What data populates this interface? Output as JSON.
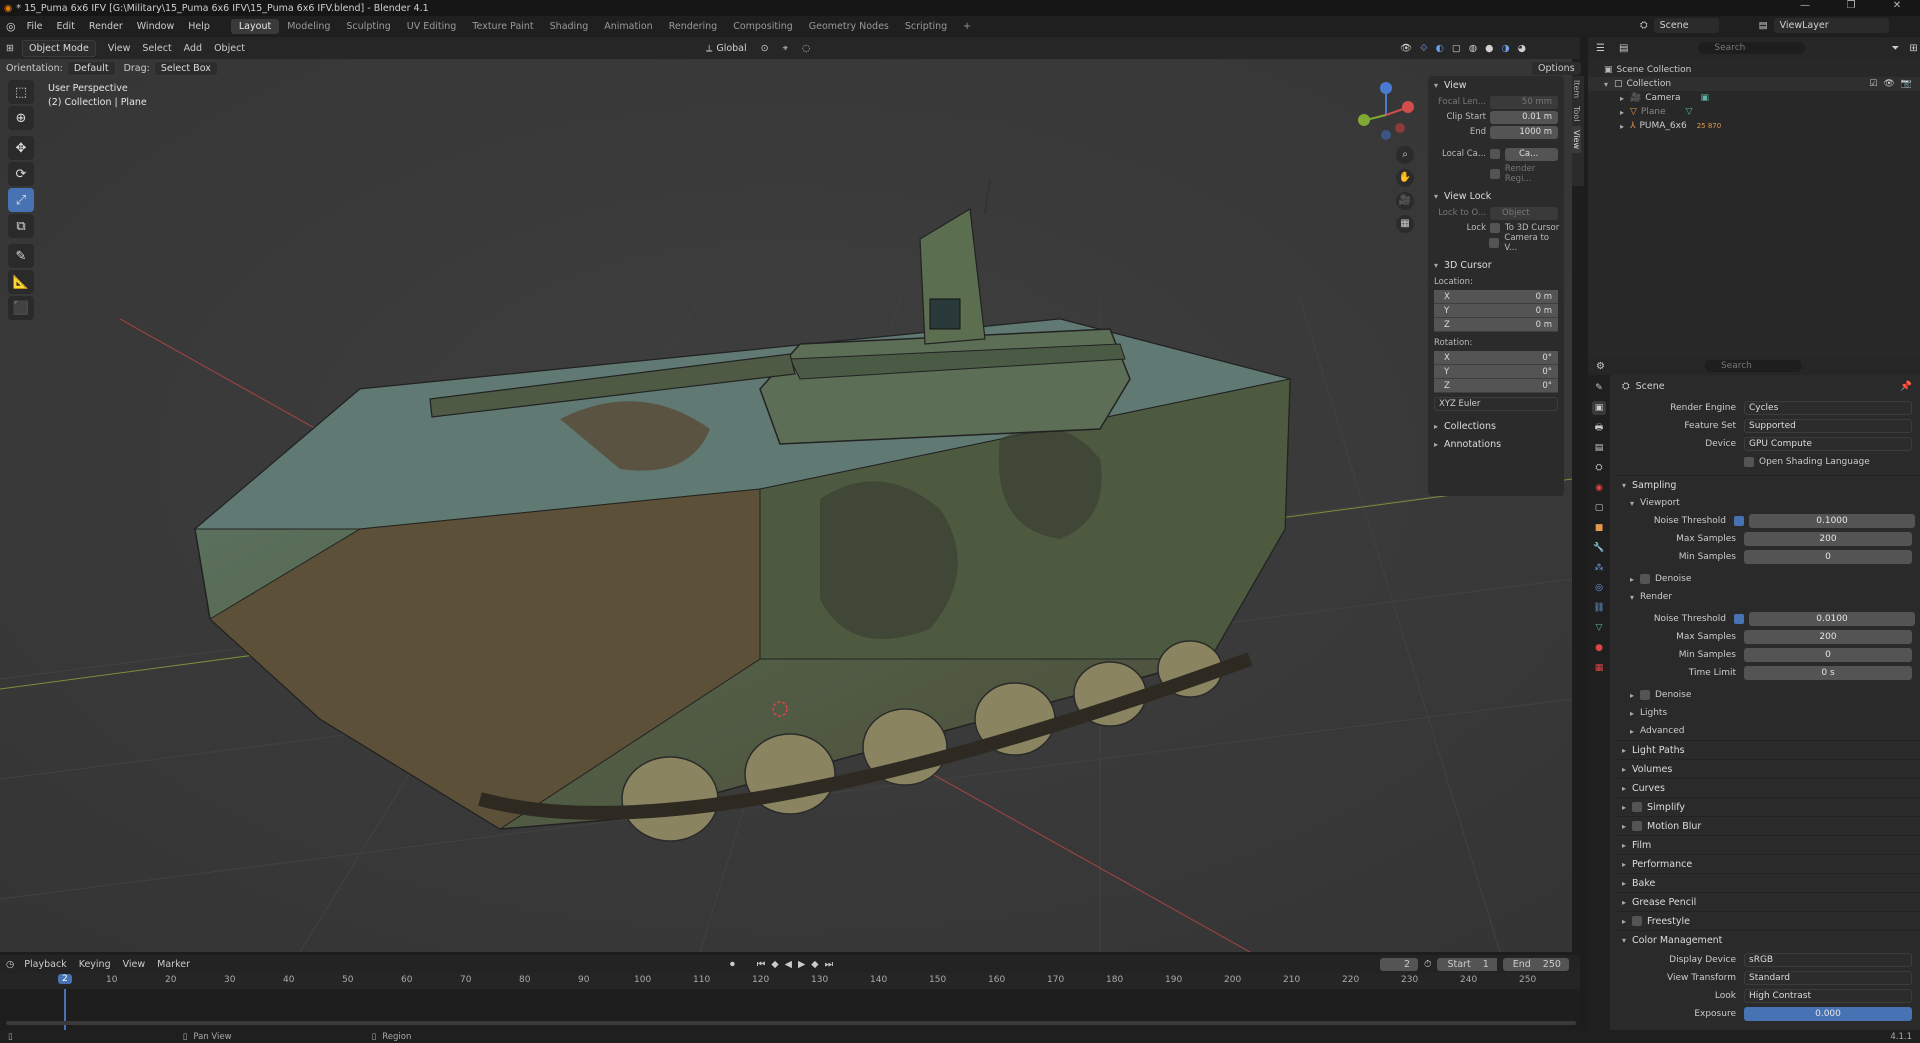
{
  "window": {
    "title": "* 15_Puma 6x6 IFV [G:\\Military\\15_Puma 6x6 IFV\\15_Puma 6x6 IFV.blend] - Blender 4.1",
    "controls": [
      "—",
      "❐",
      "✕"
    ]
  },
  "menu": {
    "items": [
      "File",
      "Edit",
      "Render",
      "Window",
      "Help"
    ],
    "workspaces": [
      "Layout",
      "Modeling",
      "Sculpting",
      "UV Editing",
      "Texture Paint",
      "Shading",
      "Animation",
      "Rendering",
      "Compositing",
      "Geometry Nodes",
      "Scripting"
    ],
    "active_workspace": "Layout",
    "add_tab": "+",
    "scene_label": "Scene",
    "viewlayer_label": "ViewLayer"
  },
  "viewport_header": {
    "mode": "Object Mode",
    "menus": [
      "View",
      "Select",
      "Add",
      "Object"
    ],
    "transform_orientation": "Global",
    "options_label": "Options",
    "orientation_label": "Orientation:",
    "orientation_value": "Default",
    "drag_label": "Drag:",
    "drag_value": "Select Box"
  },
  "viewport_info": {
    "line1": "User Perspective",
    "line2": "(2) Collection | Plane"
  },
  "npanel": {
    "tabs": [
      "Item",
      "Tool",
      "View"
    ],
    "view_section": "View",
    "focal_length_label": "Focal Len...",
    "focal_length_value": "50 mm",
    "clip_start_label": "Clip Start",
    "clip_start_value": "0.01 m",
    "clip_end_label": "End",
    "clip_end_value": "1000 m",
    "local_camera_label": "Local Ca...",
    "local_camera_value": "Ca...",
    "render_region_label": "Render Regi...",
    "view_lock_section": "View Lock",
    "lock_to_object_label": "Lock to O...",
    "lock_to_object_value": "Object",
    "lock_label": "Lock",
    "to_3d_cursor": "To 3D Cursor",
    "camera_to_view": "Camera to V...",
    "cursor_section": "3D Cursor",
    "location_label": "Location:",
    "loc": [
      {
        "axis": "X",
        "value": "0 m"
      },
      {
        "axis": "Y",
        "value": "0 m"
      },
      {
        "axis": "Z",
        "value": "0 m"
      }
    ],
    "rotation_label": "Rotation:",
    "rot": [
      {
        "axis": "X",
        "value": "0°"
      },
      {
        "axis": "Y",
        "value": "0°"
      },
      {
        "axis": "Z",
        "value": "0°"
      }
    ],
    "rotation_mode": "XYZ Euler",
    "collections_section": "Collections",
    "annotations_section": "Annotations"
  },
  "outliner": {
    "search_placeholder": "Search",
    "scene_collection": "Scene Collection",
    "collection": "Collection",
    "items": [
      {
        "name": "Camera",
        "color": "#e39a4a"
      },
      {
        "name": "Plane",
        "color": "#e39a4a"
      },
      {
        "name": "PUMA_6x6",
        "color": "#e39a4a",
        "badge": "25 870"
      }
    ]
  },
  "properties": {
    "search_placeholder": "Search",
    "scene_label": "Scene",
    "render_engine_label": "Render Engine",
    "render_engine_value": "Cycles",
    "feature_set_label": "Feature Set",
    "feature_set_value": "Supported",
    "device_label": "Device",
    "device_value": "GPU Compute",
    "osl_label": "Open Shading Language",
    "sampling": "Sampling",
    "viewport": "Viewport",
    "vp_noise_label": "Noise Threshold",
    "vp_noise_value": "0.1000",
    "vp_max_label": "Max Samples",
    "vp_max_value": "200",
    "vp_min_label": "Min Samples",
    "vp_min_value": "0",
    "denoise": "Denoise",
    "render": "Render",
    "r_noise_label": "Noise Threshold",
    "r_noise_value": "0.0100",
    "r_max_label": "Max Samples",
    "r_max_value": "200",
    "r_min_label": "Min Samples",
    "r_min_value": "0",
    "time_limit_label": "Time Limit",
    "time_limit_value": "0 s",
    "denoise2": "Denoise",
    "lights": "Lights",
    "advanced": "Advanced",
    "sections": [
      "Light Paths",
      "Volumes",
      "Curves",
      "Simplify",
      "Motion Blur",
      "Film",
      "Performance",
      "Bake",
      "Grease Pencil",
      "Freestyle"
    ],
    "color_management": "Color Management",
    "display_device_label": "Display Device",
    "display_device_value": "sRGB",
    "view_transform_label": "View Transform",
    "view_transform_value": "Standard",
    "look_label": "Look",
    "look_value": "High Contrast",
    "exposure_label": "Exposure",
    "exposure_value": "0.000"
  },
  "timeline": {
    "menus": [
      "Playback",
      "Keying",
      "View",
      "Marker"
    ],
    "current_frame": "2",
    "start_label": "Start",
    "start_value": "1",
    "end_label": "End",
    "end_value": "250",
    "frame_label": "2",
    "ticks": [
      "10",
      "20",
      "30",
      "40",
      "50",
      "60",
      "70",
      "80",
      "90",
      "100",
      "110",
      "120",
      "130",
      "140",
      "150",
      "160",
      "170",
      "180",
      "190",
      "200",
      "210",
      "220",
      "230",
      "240",
      "250"
    ]
  },
  "statusbar": {
    "pan": "Pan View",
    "region": "Region",
    "version": "4.1.1"
  },
  "colors": {
    "accent": "#4772b3",
    "object_orange": "#e39a4a",
    "grid_x": "#a83a3a",
    "grid_y": "#6b8a2a"
  }
}
